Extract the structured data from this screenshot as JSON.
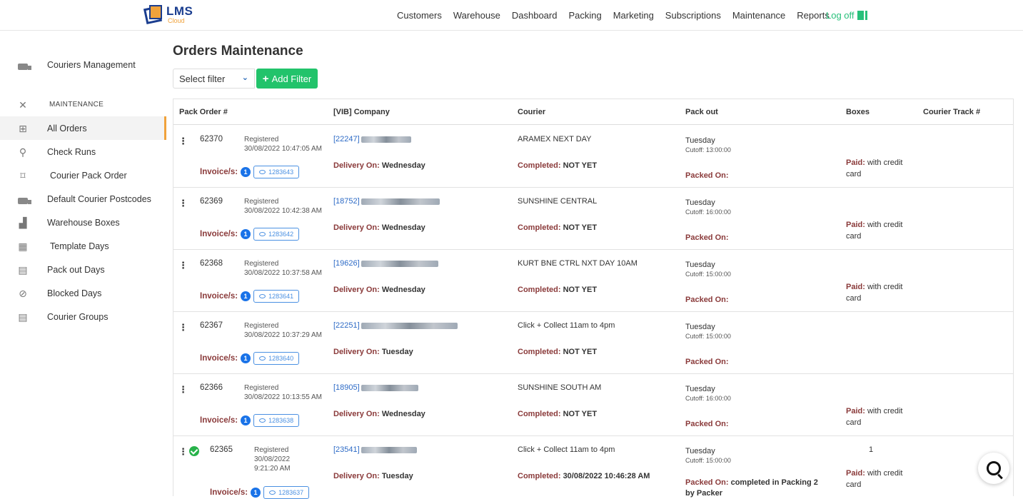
{
  "app": {
    "logo_text": "LMS",
    "logo_sub": "Cloud"
  },
  "nav": {
    "items": [
      "Customers",
      "Warehouse",
      "Dashboard",
      "Packing",
      "Marketing",
      "Subscriptions",
      "Maintenance",
      "Reports"
    ],
    "logoff": "Log off"
  },
  "sidebar": {
    "couriers_management": "Couriers Management",
    "section": "MAINTENANCE",
    "items": [
      {
        "label": "All Orders",
        "icon": "grid-icon",
        "active": true
      },
      {
        "label": "Check Runs",
        "icon": "search-icon"
      },
      {
        "label": "Courier Pack Order",
        "icon": "bookmark-icon"
      },
      {
        "label": "Default Courier Postcodes",
        "icon": "truck-icon"
      },
      {
        "label": "Warehouse Boxes",
        "icon": "boxes-icon"
      },
      {
        "label": "Template Days",
        "icon": "calendar-icon"
      },
      {
        "label": "Pack out Days",
        "icon": "calendar-icon"
      },
      {
        "label": "Blocked Days",
        "icon": "blocked-icon"
      },
      {
        "label": "Courier Groups",
        "icon": "calendar-icon"
      }
    ]
  },
  "page": {
    "title": "Orders Maintenance",
    "filter_placeholder": "Select filter",
    "add_filter": "Add Filter"
  },
  "table": {
    "headers": [
      "Pack Order #",
      "[VIB] Company",
      "Courier",
      "Pack out",
      "Boxes",
      "Courier Track #"
    ],
    "rows": [
      {
        "order": "62370",
        "status": "Registered",
        "date": "30/08/2022 10:47:05 AM",
        "invoice_label": "Invoice/s:",
        "invoice_count": "1",
        "invoice": "1283643",
        "company_code": "[22247]",
        "delivery_label": "Delivery On:",
        "delivery": "Wednesday",
        "courier": "ARAMEX NEXT DAY",
        "completed_label": "Completed:",
        "completed": "NOT YET",
        "packout_day": "Tuesday",
        "cutoff": "Cutoff: 13:00:00",
        "packed_label": "Packed On:",
        "packed": "",
        "paid_label": "Paid:",
        "paid": "with credit card",
        "boxes": ""
      },
      {
        "order": "62369",
        "status": "Registered",
        "date": "30/08/2022 10:42:38 AM",
        "invoice_label": "Invoice/s:",
        "invoice_count": "1",
        "invoice": "1283642",
        "company_code": "[18752]",
        "delivery_label": "Delivery On:",
        "delivery": "Wednesday",
        "courier": "SUNSHINE CENTRAL",
        "completed_label": "Completed:",
        "completed": "NOT YET",
        "packout_day": "Tuesday",
        "cutoff": "Cutoff: 16:00:00",
        "packed_label": "Packed On:",
        "packed": "",
        "paid_label": "Paid:",
        "paid": "with credit card",
        "boxes": ""
      },
      {
        "order": "62368",
        "status": "Registered",
        "date": "30/08/2022 10:37:58 AM",
        "invoice_label": "Invoice/s:",
        "invoice_count": "1",
        "invoice": "1283641",
        "company_code": "[19626]",
        "delivery_label": "Delivery On:",
        "delivery": "Wednesday",
        "courier": "KURT BNE CTRL NXT DAY 10AM",
        "completed_label": "Completed:",
        "completed": "NOT YET",
        "packout_day": "Tuesday",
        "cutoff": "Cutoff: 15:00:00",
        "packed_label": "Packed On:",
        "packed": "",
        "paid_label": "Paid:",
        "paid": "with credit card",
        "boxes": ""
      },
      {
        "order": "62367",
        "status": "Registered",
        "date": "30/08/2022 10:37:29 AM",
        "invoice_label": "Invoice/s:",
        "invoice_count": "1",
        "invoice": "1283640",
        "company_code": "[22251]",
        "delivery_label": "Delivery On:",
        "delivery": "Tuesday",
        "courier": "Click + Collect 11am to 4pm",
        "completed_label": "Completed:",
        "completed": "NOT YET",
        "packout_day": "Tuesday",
        "cutoff": "Cutoff: 15:00:00",
        "packed_label": "Packed On:",
        "packed": "",
        "paid_label": "",
        "paid": "",
        "boxes": ""
      },
      {
        "order": "62366",
        "status": "Registered",
        "date": "30/08/2022 10:13:55 AM",
        "invoice_label": "Invoice/s:",
        "invoice_count": "1",
        "invoice": "1283638",
        "company_code": "[18905]",
        "delivery_label": "Delivery On:",
        "delivery": "Wednesday",
        "courier": "SUNSHINE SOUTH AM",
        "completed_label": "Completed:",
        "completed": "NOT YET",
        "packout_day": "Tuesday",
        "cutoff": "Cutoff: 16:00:00",
        "packed_label": "Packed On:",
        "packed": "",
        "paid_label": "Paid:",
        "paid": "with credit card",
        "boxes": ""
      },
      {
        "order": "62365",
        "status": "Registered",
        "date": "30/08/2022 9:21:20 AM",
        "invoice_label": "Invoice/s:",
        "invoice_count": "1",
        "invoice": "1283637",
        "company_code": "[23541]",
        "delivery_label": "Delivery On:",
        "delivery": "Tuesday",
        "courier": "Click + Collect 11am to 4pm",
        "completed_label": "Completed:",
        "completed": "30/08/2022 10:46:28 AM",
        "packout_day": "Tuesday",
        "cutoff": "Cutoff: 15:00:00",
        "packed_label": "Packed On:",
        "packed": "completed in Packing 2 by Packer",
        "paid_label": "Paid:",
        "paid": "with credit card",
        "boxes": "1"
      }
    ]
  }
}
